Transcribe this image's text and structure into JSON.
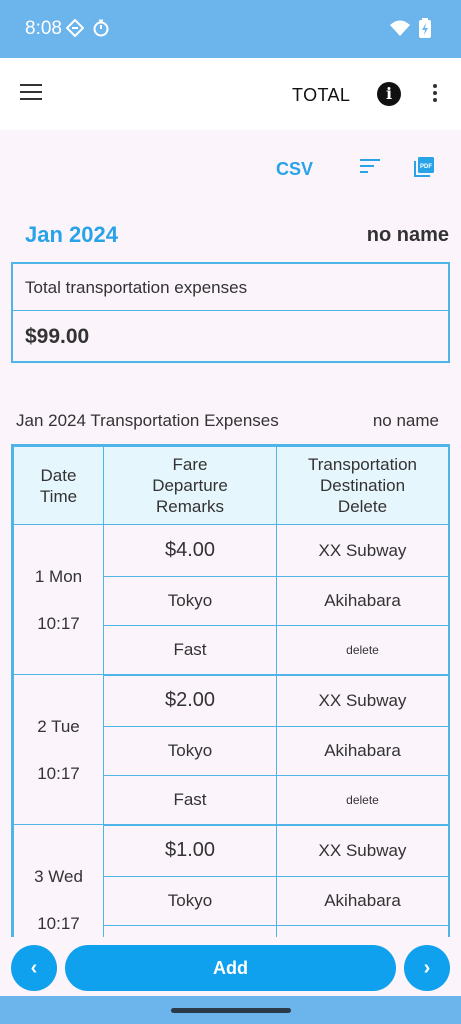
{
  "status": {
    "time": "8:08"
  },
  "app_bar": {
    "title": "TOTAL"
  },
  "toolbar": {
    "csv_label": "CSV"
  },
  "header": {
    "month": "Jan 2024",
    "owner": "no name"
  },
  "total": {
    "label": "Total transportation expenses",
    "value": "$99.00"
  },
  "section": {
    "title": "Jan 2024 Transportation Expenses",
    "owner": "no name"
  },
  "table": {
    "headers": [
      "Date\nTime",
      "Fare\nDeparture\nRemarks",
      "Transportation\nDestination\nDelete"
    ],
    "rows": [
      {
        "date": "1 Mon",
        "time": "10:17",
        "fare": "$4.00",
        "transport": "XX Subway",
        "departure": "Tokyo",
        "destination": "Akihabara",
        "remarks": "Fast",
        "delete": "delete"
      },
      {
        "date": "2 Tue",
        "time": "10:17",
        "fare": "$2.00",
        "transport": "XX Subway",
        "departure": "Tokyo",
        "destination": "Akihabara",
        "remarks": "Fast",
        "delete": "delete"
      },
      {
        "date": "3 Wed",
        "time": "10:17",
        "fare": "$1.00",
        "transport": "XX Subway",
        "departure": "Tokyo",
        "destination": "Akihabara",
        "remarks": "",
        "delete": ""
      }
    ]
  },
  "bottom": {
    "prev_label": "‹",
    "add_label": "Add",
    "next_label": "›"
  },
  "colors": {
    "accent": "#29a3e8",
    "button": "#0fa0ee",
    "status_bar": "#6cb4ec",
    "table_border": "#4fb4e8"
  }
}
